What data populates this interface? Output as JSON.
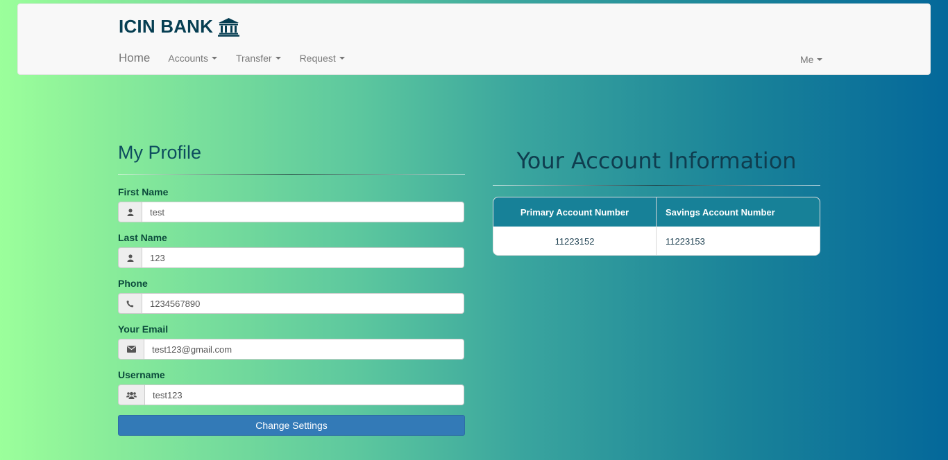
{
  "header": {
    "brand": "ICIN BANK",
    "nav": {
      "home": "Home",
      "accounts": "Accounts",
      "transfer": "Transfer",
      "request": "Request",
      "me": "Me"
    }
  },
  "profile": {
    "title": "My Profile",
    "fields": {
      "first_name": {
        "label": "First Name",
        "value": "test",
        "icon": "user-icon"
      },
      "last_name": {
        "label": "Last Name",
        "value": "123",
        "icon": "user-icon"
      },
      "phone": {
        "label": "Phone",
        "value": "1234567890",
        "icon": "phone-icon"
      },
      "email": {
        "label": "Your Email",
        "value": "test123@gmail.com",
        "icon": "envelope-icon"
      },
      "username": {
        "label": "Username",
        "value": "test123",
        "icon": "users-icon"
      }
    },
    "submit_label": "Change Settings"
  },
  "account_info": {
    "title": "Your Account Information",
    "columns": [
      "Primary Account Number",
      "Savings Account Number"
    ],
    "rows": [
      [
        "11223152",
        "11223153"
      ]
    ]
  },
  "colors": {
    "brand_text": "#063e52",
    "table_header": "#178198",
    "button": "#337ab7"
  }
}
